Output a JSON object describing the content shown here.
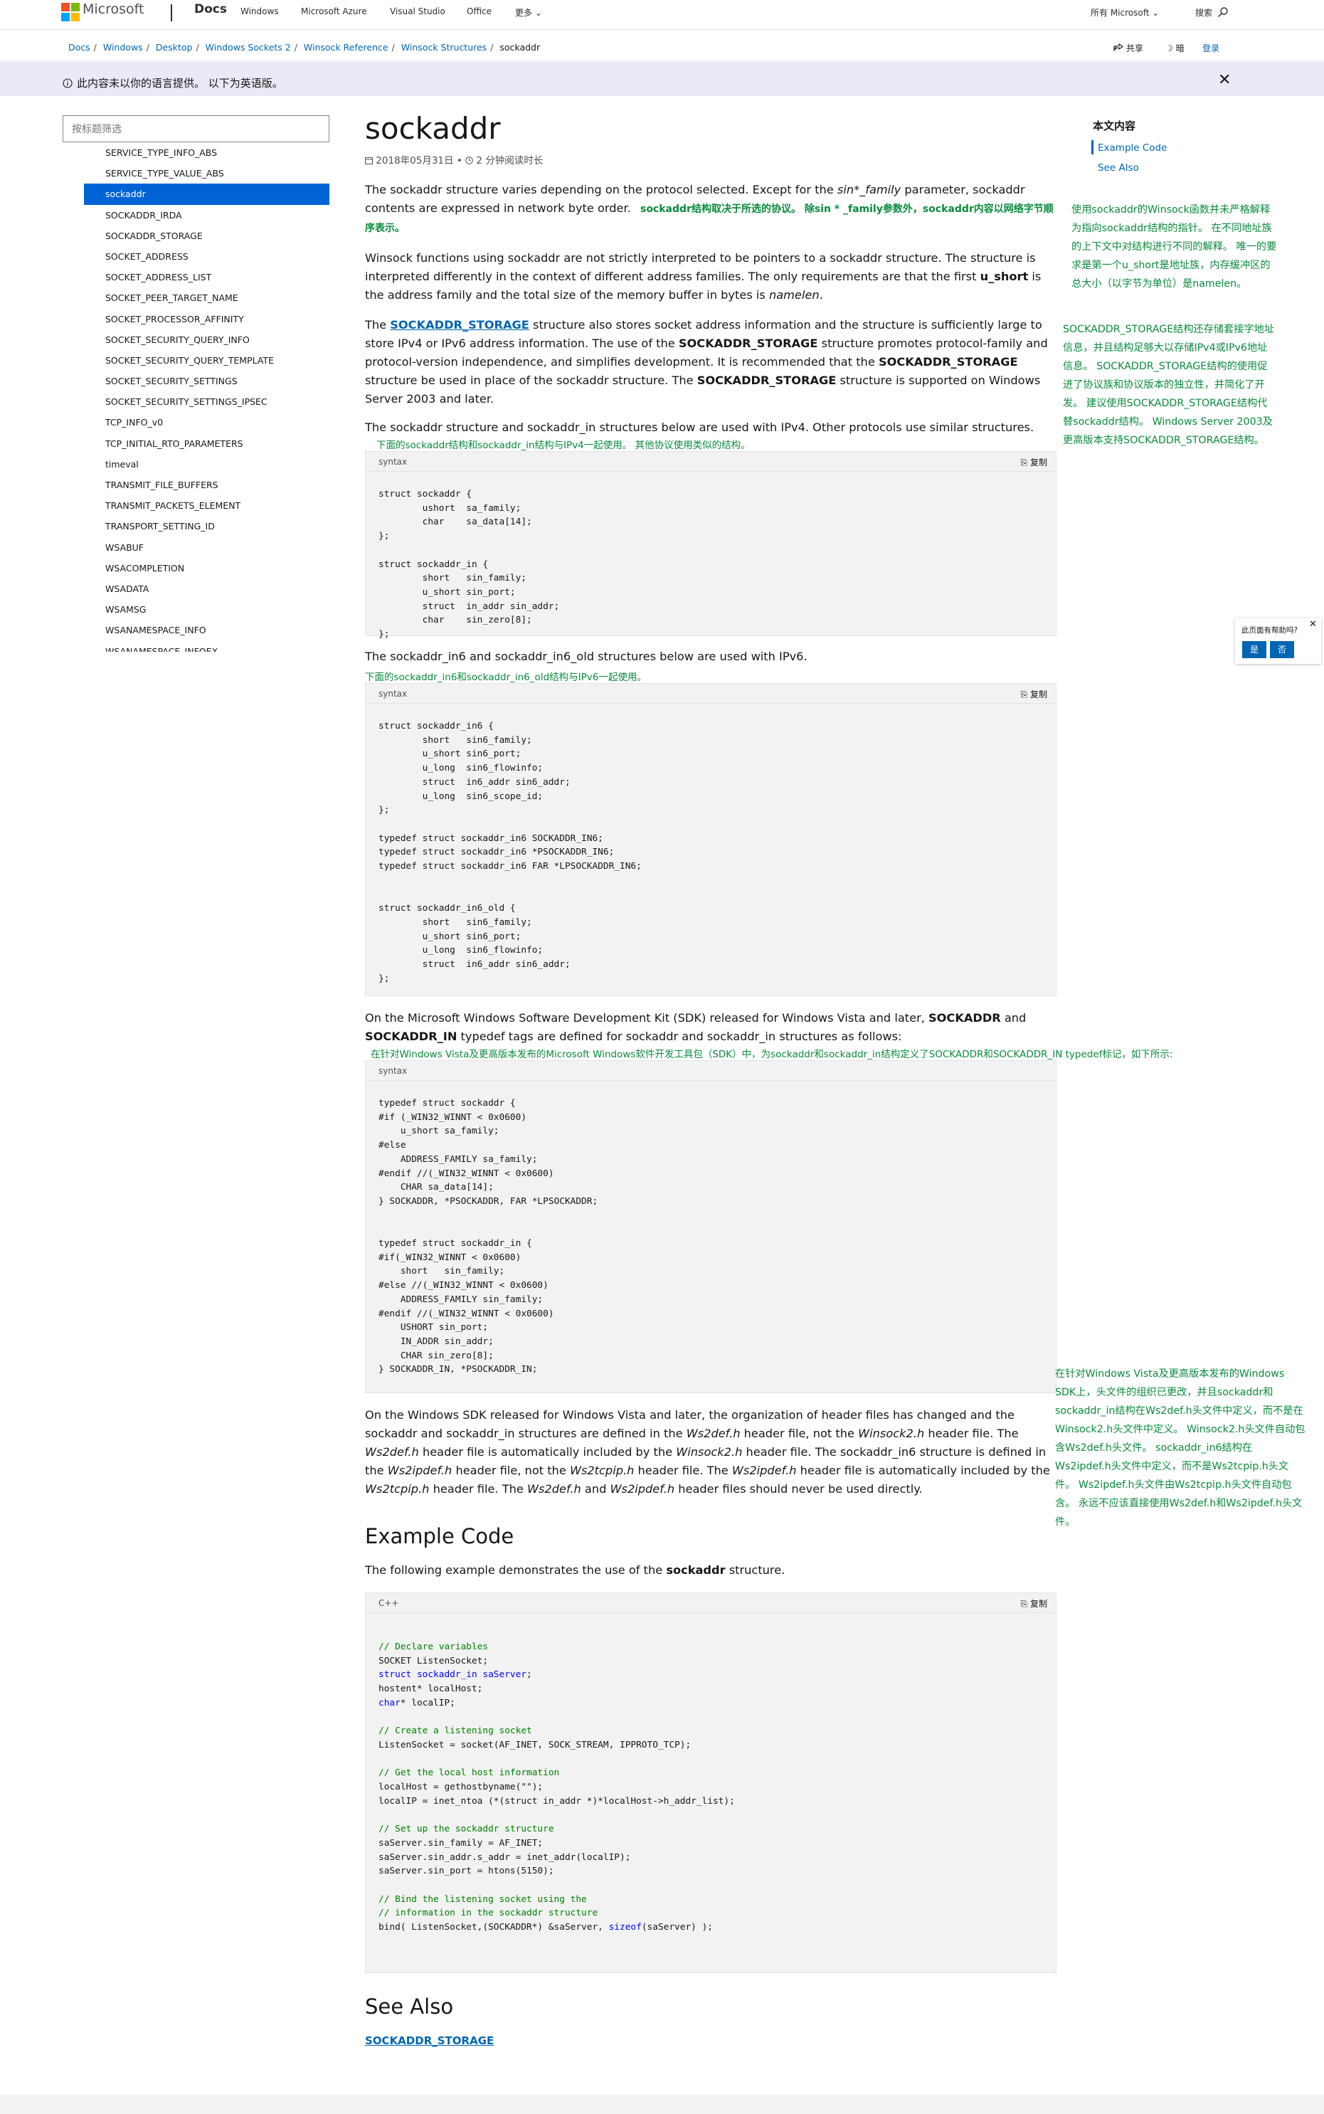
{
  "header": {
    "brand": "Microsoft",
    "site": "Docs",
    "nav": [
      "Windows",
      "Microsoft Azure",
      "Visual Studio",
      "Office",
      "更多 ⌄"
    ],
    "all_microsoft": "所有 Microsoft ⌄",
    "search": "搜索"
  },
  "colors": {
    "ms_red": "#f25022",
    "ms_green": "#7fba00",
    "ms_blue": "#00a4ef",
    "ms_yellow": "#ffb900",
    "accent": "#0065b3",
    "selected": "#0064d6",
    "translation": "#0a8a3c"
  },
  "breadcrumb": [
    "Docs",
    "Windows",
    "Desktop",
    "Windows Sockets 2",
    "Winsock Reference",
    "Winsock Structures",
    "sockaddr"
  ],
  "actions": {
    "share": "共享",
    "dark": "暗",
    "signin": "登录"
  },
  "banner": {
    "text": "此内容未以你的语言提供。 以下为英语版。"
  },
  "filter": {
    "placeholder": "按标题筛选"
  },
  "toc": [
    "SERVICE_TYPE_INFO_ABS",
    "SERVICE_TYPE_VALUE_ABS",
    "sockaddr",
    "SOCKADDR_IRDA",
    "SOCKADDR_STORAGE",
    "SOCKET_ADDRESS",
    "SOCKET_ADDRESS_LIST",
    "SOCKET_PEER_TARGET_NAME",
    "SOCKET_PROCESSOR_AFFINITY",
    "SOCKET_SECURITY_QUERY_INFO",
    "SOCKET_SECURITY_QUERY_TEMPLATE",
    "SOCKET_SECURITY_SETTINGS",
    "SOCKET_SECURITY_SETTINGS_IPSEC",
    "TCP_INFO_v0",
    "TCP_INITIAL_RTO_PARAMETERS",
    "timeval",
    "TRANSMIT_FILE_BUFFERS",
    "TRANSMIT_PACKETS_ELEMENT",
    "TRANSPORT_SETTING_ID",
    "WSABUF",
    "WSACOMPLETION",
    "WSADATA",
    "WSAMSG",
    "WSANAMESPACE_INFO",
    "WSANAMESPACE_INFOEX"
  ],
  "toc_selected": "sockaddr",
  "article": {
    "title": "sockaddr",
    "date": "2018年05月31日",
    "read_time": "2 分钟阅读时长",
    "p1_a": "The sockaddr structure varies depending on the protocol selected. Except for the ",
    "p1_i": "sin*_family",
    "p1_b": " parameter, sockaddr contents are expressed in network byte order.",
    "p1_tr": "sockaddr结构取决于所选的协议。 除sin * _family参数外，sockaddr内容以网络字节顺序表示。",
    "p2_a": "Winsock functions using sockaddr are not strictly interpreted to be pointers to a sockaddr structure. The structure is interpreted differently in the context of different address families. The only requirements are that the first ",
    "p2_b1": "u_short",
    "p2_b": " is the address family and the total size of the memory buffer in bytes is ",
    "p2_i": "namelen",
    "p2_c": ".",
    "p3_a": "The ",
    "p3_link": "SOCKADDR_STORAGE",
    "p3_b": " structure also stores socket address information and the structure is sufficiently large to store IPv4 or IPv6 address information. The use of the ",
    "p3_b1": "SOCKADDR_STORAGE",
    "p3_c": " structure promotes protocol-family and protocol-version independence, and simplifies development. It is recommended that the ",
    "p3_b2": "SOCKADDR_STORAGE",
    "p3_d": " structure be used in place of the sockaddr structure. The ",
    "p3_b3": "SOCKADDR_STORAGE",
    "p3_e": " structure is supported on Windows Server 2003 and later.",
    "p4": "The sockaddr structure and sockaddr_in structures below are used with IPv4. Other protocols use similar structures.",
    "p4_tr": "下面的sockaddr结构和sockaddr_in结构与IPv4一起使用。 其他协议使用类似的结构。",
    "code_label": "syntax",
    "copy": "复制",
    "code1": "struct sockaddr {\n        ushort  sa_family;\n        char    sa_data[14];\n};\n\nstruct sockaddr_in {\n        short   sin_family;\n        u_short sin_port;\n        struct  in_addr sin_addr;\n        char    sin_zero[8];\n};",
    "p5": "The sockaddr_in6 and sockaddr_in6_old structures below are used with IPv6.",
    "p5_tr": "下面的sockaddr_in6和sockaddr_in6_old结构与IPv6一起使用。",
    "code2": "struct sockaddr_in6 {\n        short   sin6_family;\n        u_short sin6_port;\n        u_long  sin6_flowinfo;\n        struct  in6_addr sin6_addr;\n        u_long  sin6_scope_id;\n};\n\ntypedef struct sockaddr_in6 SOCKADDR_IN6;\ntypedef struct sockaddr_in6 *PSOCKADDR_IN6;\ntypedef struct sockaddr_in6 FAR *LPSOCKADDR_IN6;\n\n\nstruct sockaddr_in6_old {\n        short   sin6_family;\n        u_short sin6_port;\n        u_long  sin6_flowinfo;\n        struct  in6_addr sin6_addr;\n};",
    "p6_a": "On the Microsoft Windows Software Development Kit (SDK) released for Windows Vista and later, ",
    "p6_b1": "SOCKADDR",
    "p6_and": " and ",
    "p6_b2": "SOCKADDR_IN",
    "p6_c": " typedef tags are defined for sockaddr and sockaddr_in structures as follows:",
    "p6_tr": "在针对Windows Vista及更高版本发布的Microsoft Windows软件开发工具包（SDK）中，为sockaddr和sockaddr_in结构定义了SOCKADDR和SOCKADDR_IN typedef标记，如下所示:",
    "code3": "typedef struct sockaddr {\n#if (_WIN32_WINNT < 0x0600)\n    u_short sa_family;\n#else\n    ADDRESS_FAMILY sa_family;\n#endif //(_WIN32_WINNT < 0x0600)\n    CHAR sa_data[14];\n} SOCKADDR, *PSOCKADDR, FAR *LPSOCKADDR;\n\n\ntypedef struct sockaddr_in {\n#if(_WIN32_WINNT < 0x0600)\n    short   sin_family;\n#else //(_WIN32_WINNT < 0x0600)\n    ADDRESS_FAMILY sin_family;\n#endif //(_WIN32_WINNT < 0x0600)\n    USHORT sin_port;\n    IN_ADDR sin_addr;\n    CHAR sin_zero[8];\n} SOCKADDR_IN, *PSOCKADDR_IN;",
    "p7_a": "On the Windows SDK released for Windows Vista and later, the organization of header files has changed and the sockaddr and sockaddr_in structures are defined in the ",
    "p7_i1": "Ws2def.h",
    "p7_b": " header file, not the ",
    "p7_i2": "Winsock2.h",
    "p7_c": " header file. The ",
    "p7_i3": "Ws2def.h",
    "p7_d": " header file is automatically included by the ",
    "p7_i4": "Winsock2.h",
    "p7_e": " header file. The sockaddr_in6 structure is defined in the ",
    "p7_i5": "Ws2ipdef.h",
    "p7_f": " header file, not the ",
    "p7_i6": "Ws2tcpip.h",
    "p7_g": " header file. The ",
    "p7_i7": "Ws2ipdef.h",
    "p7_h": " header file is automatically included by the ",
    "p7_i8": "Ws2tcpip.h",
    "p7_j": " header file. The ",
    "p7_i9": "Ws2def.h",
    "p7_and": " and ",
    "p7_i10": "Ws2ipdef.h",
    "p7_k": " header files should never be used directly.",
    "example_heading": "Example Code",
    "p8_a": "The following example demonstrates the use of the ",
    "p8_b": "sockaddr",
    "p8_c": " structure.",
    "code4_label": "C++",
    "see_also_heading": "See Also",
    "see_also_link": "SOCKADDR_STORAGE"
  },
  "code4_lines": [
    [
      {
        "t": "// Declare variables",
        "c": "cm"
      }
    ],
    [
      {
        "t": "SOCKET ListenSocket;",
        "c": ""
      }
    ],
    [
      {
        "t": "struct",
        "c": "kw"
      },
      {
        "t": " sockaddr_in saServer",
        "c": "kw"
      },
      {
        "t": ";",
        "c": ""
      }
    ],
    [
      {
        "t": "hostent* localHost;",
        "c": ""
      }
    ],
    [
      {
        "t": "char",
        "c": "kw"
      },
      {
        "t": "* localIP;",
        "c": ""
      }
    ],
    [
      {
        "t": "",
        "c": ""
      }
    ],
    [
      {
        "t": "// Create a listening socket",
        "c": "cm"
      }
    ],
    [
      {
        "t": "ListenSocket = socket(AF_INET, SOCK_STREAM, IPPROTO_TCP);",
        "c": ""
      }
    ],
    [
      {
        "t": "",
        "c": ""
      }
    ],
    [
      {
        "t": "// Get the local host information",
        "c": "cm"
      }
    ],
    [
      {
        "t": "localHost = gethostbyname(\"\");",
        "c": ""
      }
    ],
    [
      {
        "t": "localIP = inet_ntoa (*(struct in_addr *)*localHost->h_addr_list);",
        "c": ""
      }
    ],
    [
      {
        "t": "",
        "c": ""
      }
    ],
    [
      {
        "t": "// Set up the sockaddr structure",
        "c": "cm"
      }
    ],
    [
      {
        "t": "saServer.sin_family = AF_INET;",
        "c": ""
      }
    ],
    [
      {
        "t": "saServer.sin_addr.s_addr = inet_addr(localIP);",
        "c": ""
      }
    ],
    [
      {
        "t": "saServer.sin_port = htons(5150);",
        "c": ""
      }
    ],
    [
      {
        "t": "",
        "c": ""
      }
    ],
    [
      {
        "t": "// Bind the listening socket using the",
        "c": "cm"
      }
    ],
    [
      {
        "t": "// information in the sockaddr structure",
        "c": "cm"
      }
    ],
    [
      {
        "t": "bind( ListenSocket,(SOCKADDR*) &saServer, ",
        "c": ""
      },
      {
        "t": "sizeof",
        "c": "kw"
      },
      {
        "t": "(saServer) );",
        "c": ""
      }
    ]
  ],
  "rail": {
    "title": "本文内容",
    "example": "Example Code",
    "see_also": "See Also"
  },
  "side_notes": {
    "n1": "使用sockaddr的Winsock函数并未严格解释为指向sockaddr结构的指针。 在不同地址族的上下文中对结构进行不同的解释。 唯一的要求是第一个u_short是地址族，内存缓冲区的总大小（以字节为单位）是namelen。",
    "n2": "SOCKADDR_STORAGE结构还存储套接字地址信息，并且结构足够大以存储IPv4或IPv6地址信息。 SOCKADDR_STORAGE结构的使用促进了协议族和协议版本的独立性，并简化了开发。 建议使用SOCKADDR_STORAGE结构代替sockaddr结构。 Windows Server 2003及更高版本支持SOCKADDR_STORAGE结构。",
    "n3": "在针对Windows Vista及更高版本发布的Windows SDK上，头文件的组织已更改，并且sockaddr和sockaddr_in结构在Ws2def.h头文件中定义，而不是在Winsock2.h头文件中定义。 Winsock2.h头文件自动包含Ws2def.h头文件。 sockaddr_in6结构在Ws2ipdef.h头文件中定义，而不是Ws2tcpip.h头文件。 Ws2ipdef.h头文件由Ws2tcpip.h头文件自动包含。 永远不应该直接使用Ws2def.h和Ws2ipdef.h头文件。"
  },
  "feedback": {
    "question": "此页面有帮助吗?",
    "yes": "是",
    "no": "否",
    "close": "✕"
  }
}
